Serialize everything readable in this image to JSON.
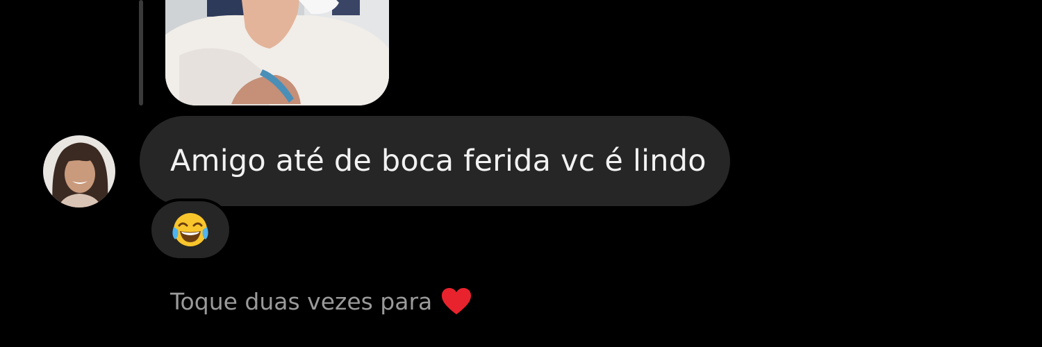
{
  "thread": {
    "reply_photo": {
      "alt": "",
      "icon": "photo-thumbnail"
    },
    "message": {
      "text": "Amigo até de boca ferida vc é lindo",
      "bubble_color": "#262626",
      "text_color": "#f2f2f2"
    },
    "reaction": {
      "emoji": "😂",
      "icon": "face-with-tears-of-joy-icon"
    },
    "hint": {
      "text": "Toque duas vezes para",
      "icon": "heart-icon",
      "heart_color": "#e8232d"
    }
  },
  "theme": {
    "background": "#000000",
    "hint_color": "#9a9a9a"
  }
}
